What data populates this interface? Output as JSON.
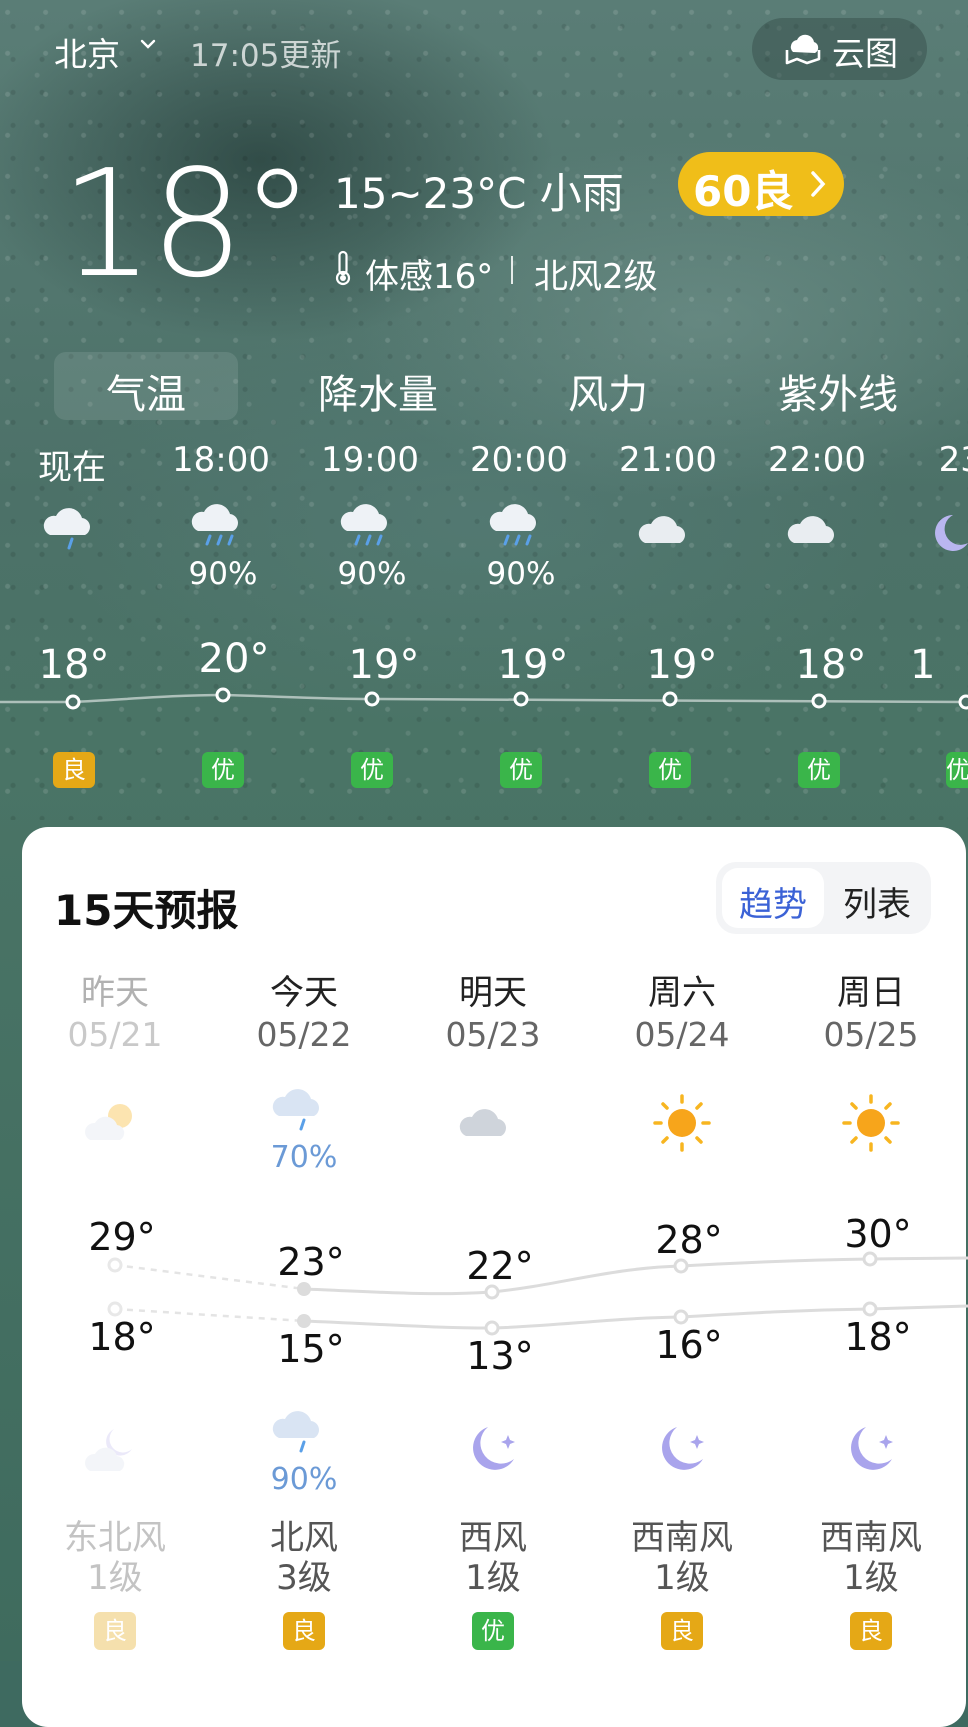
{
  "header": {
    "city": "北京",
    "updated": "17:05更新",
    "cloudmap_label": "云图"
  },
  "current": {
    "temp": "18°",
    "range_desc": "15~23°C  小雨",
    "aqi": "60良",
    "feels": "体感16°",
    "wind": "北风2级"
  },
  "tabs": [
    "气温",
    "降水量",
    "风力",
    "紫外线"
  ],
  "hourly": [
    {
      "time": "现在",
      "icon": "light-rain-icon",
      "prob": "",
      "temp": "18°",
      "aqi": "良",
      "aqi_color": "#e5a816"
    },
    {
      "time": "18:00",
      "icon": "rain-icon",
      "prob": "90%",
      "temp": "20°",
      "aqi": "优",
      "aqi_color": "#3ab54a"
    },
    {
      "time": "19:00",
      "icon": "rain-icon",
      "prob": "90%",
      "temp": "19°",
      "aqi": "优",
      "aqi_color": "#3ab54a"
    },
    {
      "time": "20:00",
      "icon": "rain-icon",
      "prob": "90%",
      "temp": "19°",
      "aqi": "优",
      "aqi_color": "#3ab54a"
    },
    {
      "time": "21:00",
      "icon": "cloudy-icon",
      "prob": "",
      "temp": "19°",
      "aqi": "优",
      "aqi_color": "#3ab54a"
    },
    {
      "time": "22:00",
      "icon": "cloudy-icon",
      "prob": "",
      "temp": "18°",
      "aqi": "优",
      "aqi_color": "#3ab54a"
    },
    {
      "time": "23:",
      "icon": "moon-icon",
      "prob": "",
      "temp": "1",
      "aqi": "优",
      "aqi_color": "#3ab54a"
    }
  ],
  "forecast": {
    "title": "15天预报",
    "toggle_trend": "趋势",
    "toggle_list": "列表",
    "days": [
      {
        "name": "昨天",
        "date": "05/21",
        "day_icon": "partly-sunny-icon",
        "day_prob": "",
        "hi": "29°",
        "lo": "18°",
        "night_icon": "cloudy-moon-icon",
        "night_prob": "",
        "wind_dir": "东北风",
        "wind_lvl": "1级",
        "aqi": "良",
        "aqi_color": "#e5a816"
      },
      {
        "name": "今天",
        "date": "05/22",
        "day_icon": "rain-icon",
        "day_prob": "70%",
        "hi": "23°",
        "lo": "15°",
        "night_icon": "rain-icon",
        "night_prob": "90%",
        "wind_dir": "北风",
        "wind_lvl": "3级",
        "aqi": "良",
        "aqi_color": "#e5a816"
      },
      {
        "name": "明天",
        "date": "05/23",
        "day_icon": "cloudy-icon",
        "day_prob": "",
        "hi": "22°",
        "lo": "13°",
        "night_icon": "moon-icon",
        "night_prob": "",
        "wind_dir": "西风",
        "wind_lvl": "1级",
        "aqi": "优",
        "aqi_color": "#3ab54a"
      },
      {
        "name": "周六",
        "date": "05/24",
        "day_icon": "sunny-icon",
        "day_prob": "",
        "hi": "28°",
        "lo": "16°",
        "night_icon": "moon-icon",
        "night_prob": "",
        "wind_dir": "西南风",
        "wind_lvl": "1级",
        "aqi": "良",
        "aqi_color": "#e5a816"
      },
      {
        "name": "周日",
        "date": "05/25",
        "day_icon": "sunny-icon",
        "day_prob": "",
        "hi": "30°",
        "lo": "18°",
        "night_icon": "moon-icon",
        "night_prob": "",
        "wind_dir": "西南风",
        "wind_lvl": "1级",
        "aqi": "良",
        "aqi_color": "#e5a816"
      }
    ]
  }
}
